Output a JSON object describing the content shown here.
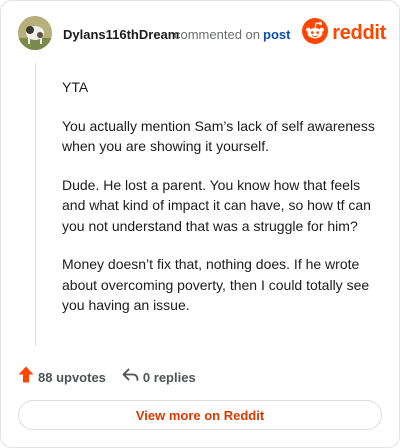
{
  "comment": {
    "username": "Dylans116thDream",
    "commented_text": "commented on",
    "post_link": "post",
    "paragraphs": [
      "YTA",
      "You actually mention Sam’s lack of self awareness when you are showing it yourself.",
      "Dude. He lost a parent. You know how that feels and what kind of impact it can have, so how tf can you not understand that was a struggle for him?",
      "Money doesn’t fix that, nothing does. If he wrote about overcoming poverty, then I could totally see you having an issue."
    ]
  },
  "brand": {
    "name": "reddit",
    "icon": "reddit-logo-icon",
    "color": "#ff4500"
  },
  "actions": {
    "upvotes_label": "88 upvotes",
    "upvote_icon": "upvote-arrow-icon",
    "replies_label": "0 replies",
    "reply_icon": "reply-arrow-icon"
  },
  "footer": {
    "view_more_label": "View more on Reddit"
  }
}
